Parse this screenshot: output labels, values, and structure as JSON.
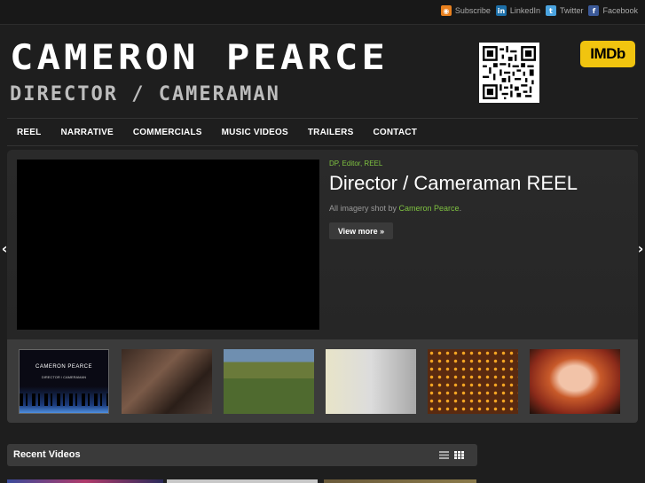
{
  "topbar": {
    "links": [
      {
        "label": "Subscribe",
        "icon": "rss-icon"
      },
      {
        "label": "LinkedIn",
        "icon": "linkedin-icon"
      },
      {
        "label": "Twitter",
        "icon": "twitter-icon"
      },
      {
        "label": "Facebook",
        "icon": "facebook-icon"
      }
    ]
  },
  "header": {
    "title": "CAMERON PEARCE",
    "subtitle": "DIRECTOR / CAMERAMAN",
    "imdb_label": "IMDb"
  },
  "nav": {
    "items": [
      "REEL",
      "NARRATIVE",
      "COMMERCIALS",
      "MUSIC VIDEOS",
      "TRAILERS",
      "CONTACT"
    ]
  },
  "slide": {
    "categories": "DP, Editor, REEL",
    "title": "Director / Cameraman REEL",
    "desc_prefix": "All imagery shot by ",
    "desc_link": "Cameron Pearce",
    "desc_suffix": ".",
    "view_more": "View more »"
  },
  "thumbnails": {
    "first_title": "CAMERON PEARCE",
    "first_subtitle": "DIRECTOR / CAMERAMAN"
  },
  "recent": {
    "title": "Recent Videos"
  },
  "colors": {
    "accent_green": "#7fc241",
    "imdb_yellow": "#f1c40f",
    "background": "#1e1e1e"
  }
}
